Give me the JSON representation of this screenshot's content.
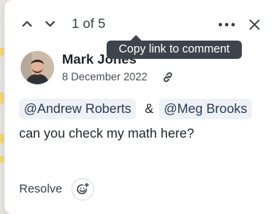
{
  "nav": {
    "counter": "1 of 5"
  },
  "tooltip": {
    "text": "Copy link to comment"
  },
  "comment": {
    "author": "Mark Jones",
    "date": "8 December 2022",
    "mentions": [
      "@Andrew Roberts",
      "@Meg Brooks"
    ],
    "connector": "&",
    "text": "can you check my math here?"
  },
  "footer": {
    "resolve_label": "Resolve"
  },
  "icons": {
    "prev": "chevron-up-icon",
    "next": "chevron-down-icon",
    "more": "more-horizontal-icon",
    "close": "close-icon",
    "link": "link-icon",
    "emoji": "add-emoji-icon"
  },
  "colors": {
    "tooltip_bg": "#3e444c",
    "mention_bg": "#eef1f5",
    "highlight": "#f6d86b"
  }
}
